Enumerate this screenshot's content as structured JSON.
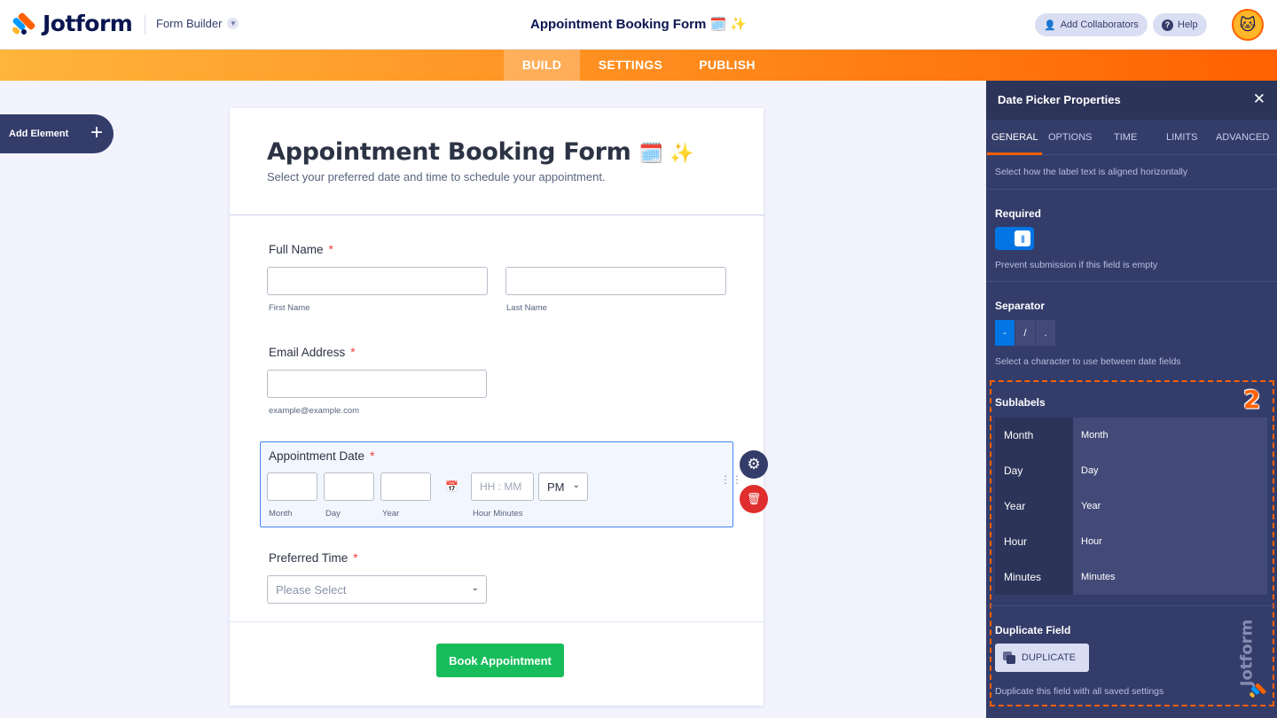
{
  "topbar": {
    "brand": "Jotform",
    "mode_label": "Form Builder",
    "title": "Appointment Booking Form",
    "title_emoji": "🗓️ ✨",
    "collaborators_label": "Add Collaborators",
    "help_label": "Help"
  },
  "nav": {
    "tabs": [
      "BUILD",
      "SETTINGS",
      "PUBLISH"
    ],
    "active": "BUILD"
  },
  "add_element": {
    "label": "Add Element",
    "icon": "plus-icon"
  },
  "form": {
    "title": "Appointment Booking Form",
    "title_emoji": "🗓️ ✨",
    "subtitle": "Select your preferred date and time to schedule your appointment.",
    "full_name": {
      "label": "Full Name",
      "required_mark": "*",
      "first_sub": "First Name",
      "last_sub": "Last Name"
    },
    "email": {
      "label": "Email Address",
      "required_mark": "*",
      "sub": "example@example.com"
    },
    "date": {
      "label": "Appointment Date",
      "required_mark": "*",
      "month_sub": "Month",
      "day_sub": "Day",
      "year_sub": "Year",
      "time_placeholder": "HH : MM",
      "ampm": "PM",
      "time_sub": "Hour Minutes"
    },
    "preferred_time": {
      "label": "Preferred Time",
      "required_mark": "*",
      "placeholder": "Please Select"
    },
    "submit_label": "Book Appointment"
  },
  "panel": {
    "title": "Date Picker Properties",
    "tabs": [
      "GENERAL",
      "OPTIONS",
      "TIME",
      "LIMITS",
      "ADVANCED"
    ],
    "active_tab": "GENERAL",
    "align_desc": "Select how the label text is aligned horizontally",
    "required": {
      "heading": "Required",
      "on": true,
      "desc": "Prevent submission if this field is empty"
    },
    "separator": {
      "heading": "Separator",
      "options": [
        "-",
        "/",
        "."
      ],
      "selected": "-",
      "desc": "Select a character to use between date fields"
    },
    "sublabels": {
      "heading": "Sublabels",
      "rows": [
        {
          "key": "Month",
          "value": "Month"
        },
        {
          "key": "Day",
          "value": "Day"
        },
        {
          "key": "Year",
          "value": "Year"
        },
        {
          "key": "Hour",
          "value": "Hour"
        },
        {
          "key": "Minutes",
          "value": "Minutes"
        }
      ]
    },
    "duplicate": {
      "heading": "Duplicate Field",
      "button_label": "DUPLICATE",
      "desc": "Duplicate this field with all saved settings"
    },
    "annotation_number": "2",
    "watermark": "Jotform"
  },
  "colors": {
    "accent_orange": "#ff6100",
    "panel_bg": "#343c6a",
    "toggle_on": "#0075e3",
    "submit_green": "#18bd5b",
    "required_red": "#f23a3c"
  }
}
